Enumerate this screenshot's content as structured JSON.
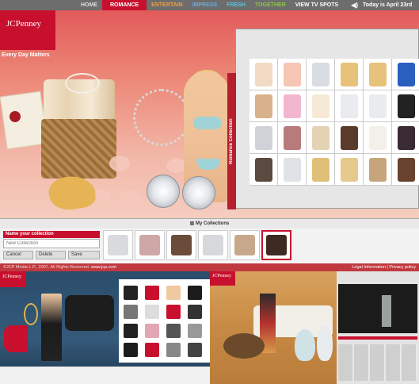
{
  "nav": {
    "items": [
      {
        "label": "HOME",
        "color": "#dddddd",
        "active": false
      },
      {
        "label": "ROMANCE",
        "color": "#ffffff",
        "active": true
      },
      {
        "label": "ENTERTAIN",
        "color": "#f39c3a",
        "active": false
      },
      {
        "label": "IMPRESS",
        "color": "#6fa8dc",
        "active": false
      },
      {
        "label": "FRESH",
        "color": "#5bc0de",
        "active": false
      },
      {
        "label": "TOGETHER",
        "color": "#8dc63f",
        "active": false
      },
      {
        "label": "VIEW TV SPOTS",
        "color": "#ffffff",
        "active": false
      }
    ],
    "speaker_icon": "speaker-icon",
    "date": "Today is April 23rd"
  },
  "brand": {
    "logo": "JCPenney",
    "tagline": "Every Day Matters",
    "color": "#c8102e"
  },
  "collection_panel": {
    "tab_label": "Romance Collection",
    "grid_colors": [
      "#f1d9c3",
      "#f4c6b3",
      "#d9dde3",
      "#e6c27a",
      "#e6c27a",
      "#2b5fbf",
      "#d8b28a",
      "#f2b7cf",
      "#f6e9d6",
      "#e9ebef",
      "#e9ebef",
      "#222222",
      "#cfd3d8",
      "#b87b7b",
      "#e4d2b5",
      "#5a3a2a",
      "#f3f0ea",
      "#3a2a33",
      "#5b4a3f",
      "#dfe2e6",
      "#e0c078",
      "#e6c98c",
      "#c6a57c",
      "#6a4230"
    ]
  },
  "my_collections": {
    "title": "My Collections",
    "name_label": "Name your collection",
    "name_placeholder": "New Collection",
    "cancel": "Cancel",
    "delete": "Delete",
    "save": "Save",
    "items": [
      "#d8dadd",
      "#cfa7a7",
      "#6b4c3a",
      "#d6d8dc",
      "#c8a88a",
      "#3d2a22"
    ]
  },
  "footer": {
    "copyright": "©JCP Media L.P., 2007, All Rights Reserved.",
    "site": "www.jcp.com",
    "legal": "Legal Information",
    "privacy": "Privacy policy"
  },
  "lower": {
    "logo": "JCPenney"
  }
}
